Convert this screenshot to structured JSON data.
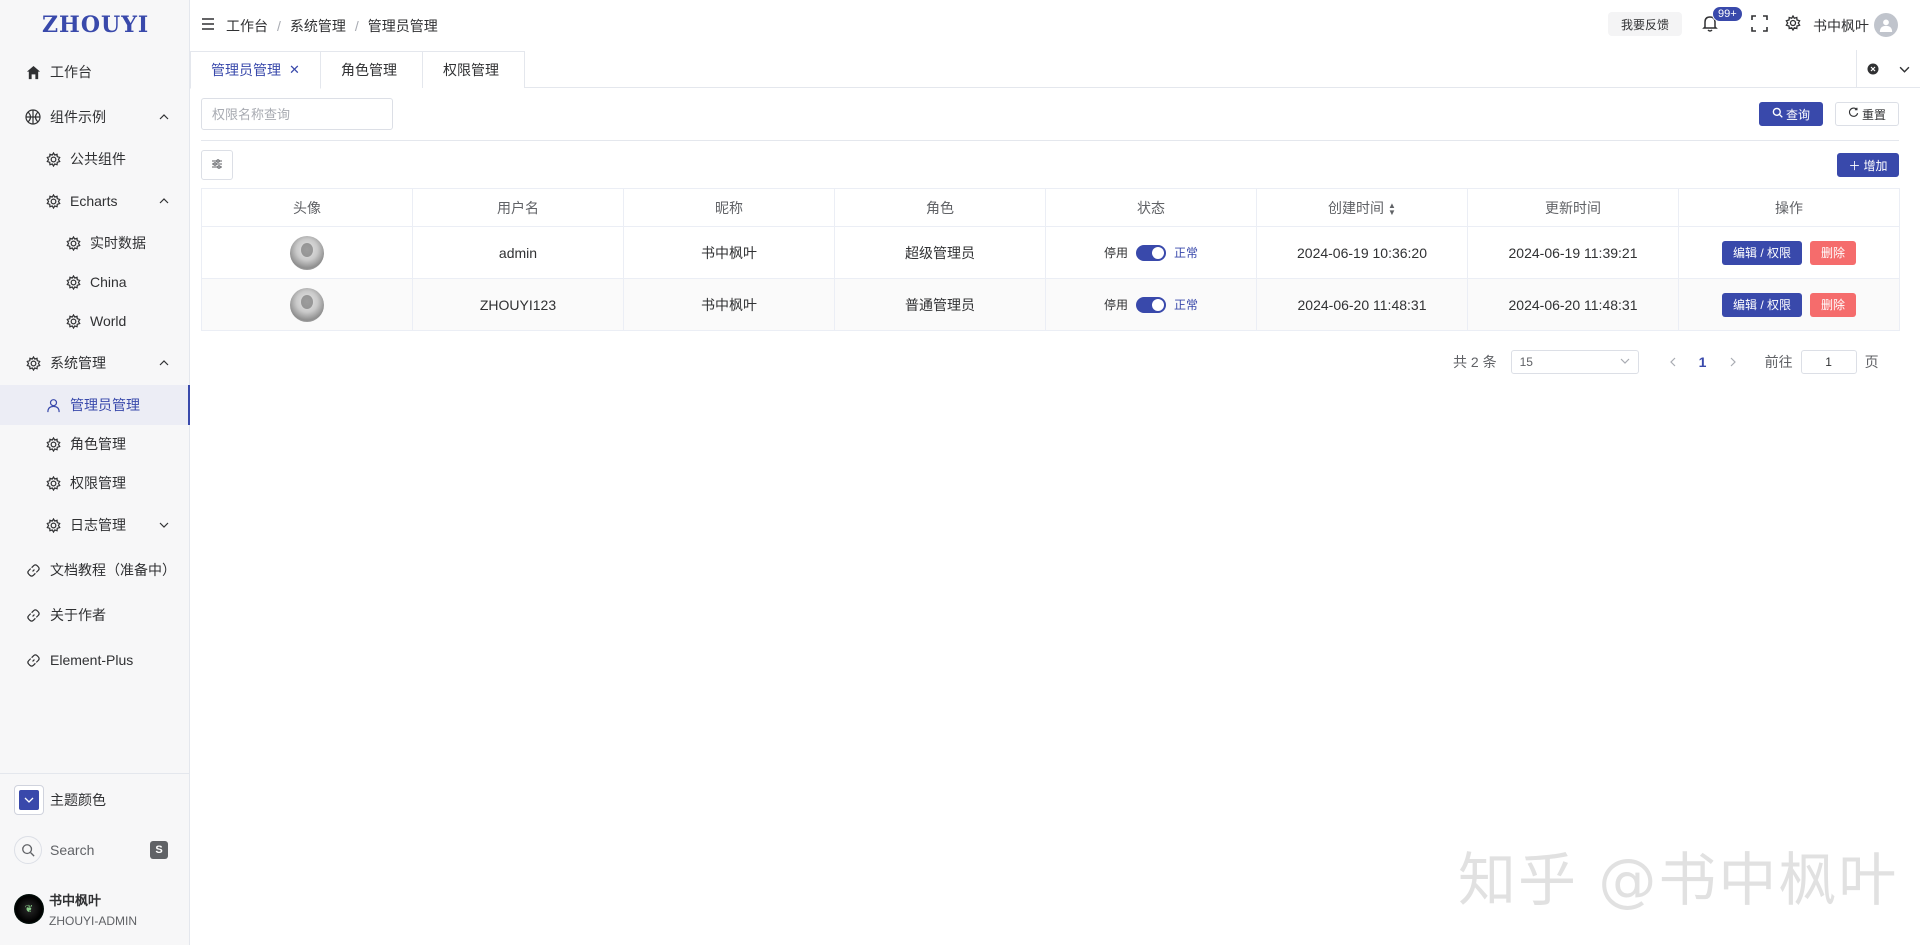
{
  "app": {
    "logo": "ZHOUYI"
  },
  "sidebar": {
    "items": [
      {
        "label": "工作台",
        "icon": "home-icon"
      },
      {
        "label": "组件示例",
        "icon": "basketball-icon"
      },
      {
        "label": "公共组件",
        "icon": "gear-icon"
      },
      {
        "label": "Echarts",
        "icon": "gear-icon"
      },
      {
        "label": "实时数据",
        "icon": "gear-icon"
      },
      {
        "label": "China",
        "icon": "gear-icon"
      },
      {
        "label": "World",
        "icon": "gear-icon"
      },
      {
        "label": "系统管理",
        "icon": "gear-icon"
      },
      {
        "label": "管理员管理",
        "icon": "user-icon"
      },
      {
        "label": "角色管理",
        "icon": "gear-icon"
      },
      {
        "label": "权限管理",
        "icon": "gear-icon"
      },
      {
        "label": "日志管理",
        "icon": "gear-icon"
      },
      {
        "label": "文档教程（准备中）",
        "icon": "link-icon"
      },
      {
        "label": "关于作者",
        "icon": "link-icon"
      },
      {
        "label": "Element-Plus",
        "icon": "link-icon"
      }
    ],
    "theme_label": "主题颜色",
    "search_label": "Search",
    "search_key": "S",
    "user": {
      "name": "书中枫叶",
      "role": "ZHOUYI-ADMIN"
    }
  },
  "header": {
    "breadcrumb": [
      "工作台",
      "系统管理",
      "管理员管理"
    ],
    "feedback": "我要反馈",
    "badge": "99+",
    "username": "书中枫叶"
  },
  "tabs": [
    {
      "label": "管理员管理",
      "closable": true
    },
    {
      "label": "角色管理"
    },
    {
      "label": "权限管理"
    }
  ],
  "toolbar": {
    "search_placeholder": "权限名称查询",
    "query_label": "查询",
    "reset_label": "重置",
    "add_label": "增加"
  },
  "table": {
    "headers": [
      "头像",
      "用户名",
      "昵称",
      "角色",
      "状态",
      "创建时间",
      "更新时间",
      "操作"
    ],
    "rows": [
      {
        "username": "admin",
        "nickname": "书中枫叶",
        "role": "超级管理员",
        "status_off": "停用",
        "status_on": "正常",
        "created": "2024-06-19 10:36:20",
        "updated": "2024-06-19 11:39:21",
        "edit": "编辑 / 权限",
        "delete": "删除"
      },
      {
        "username": "ZHOUYI123",
        "nickname": "书中枫叶",
        "role": "普通管理员",
        "status_off": "停用",
        "status_on": "正常",
        "created": "2024-06-20 11:48:31",
        "updated": "2024-06-20 11:48:31",
        "edit": "编辑 / 权限",
        "delete": "删除"
      }
    ]
  },
  "pagination": {
    "total": "共 2 条",
    "page_size": "15",
    "current": "1",
    "goto_label": "前往",
    "goto_value": "1",
    "page_suffix": "页"
  },
  "watermark": "知乎 @书中枫叶",
  "colors": {
    "primary": "#3949ab",
    "danger": "#f56c6c"
  }
}
